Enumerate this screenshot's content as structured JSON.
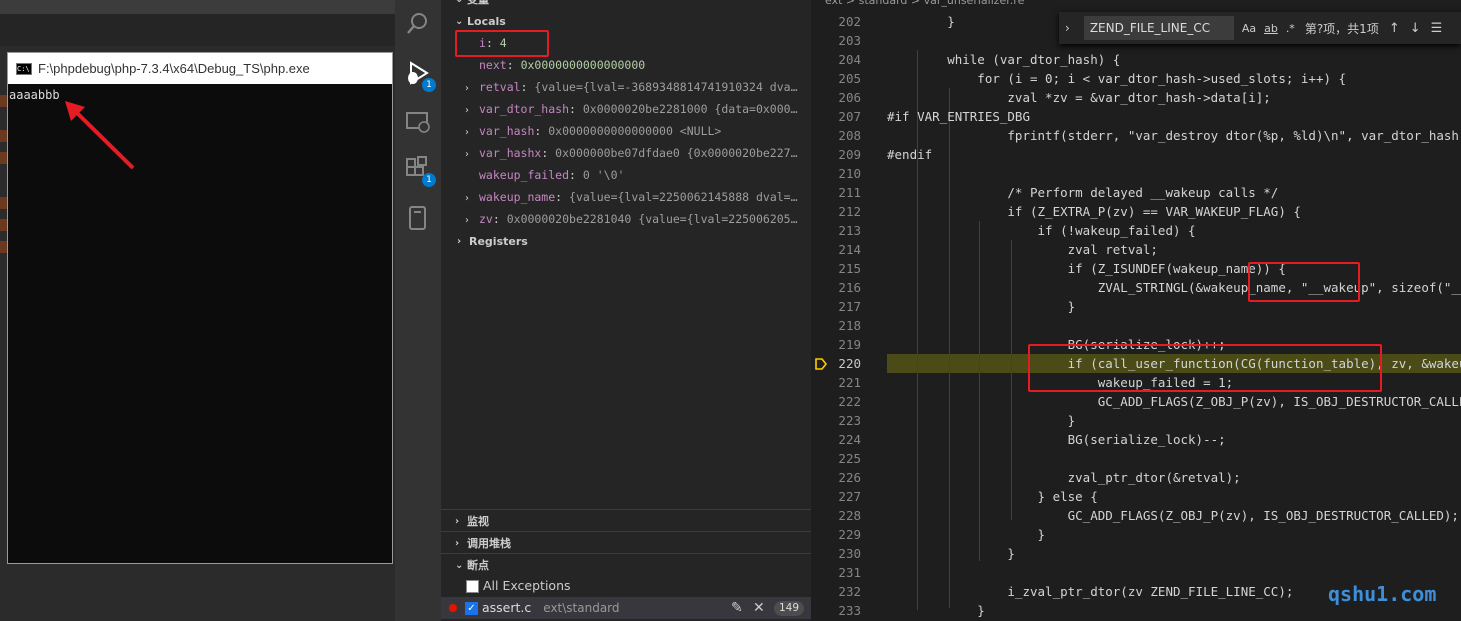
{
  "console": {
    "title": "F:\\phpdebug\\php-7.3.4\\x64\\Debug_TS\\php.exe",
    "output": "aaaabbb",
    "icon_label": "C:\\"
  },
  "activity_bar": {
    "items": [
      {
        "icon": "search-icon"
      },
      {
        "icon": "debug-icon",
        "badge": "1"
      },
      {
        "icon": "remote-explorer-icon"
      },
      {
        "icon": "extensions-icon",
        "badge": "1"
      },
      {
        "icon": "device-icon"
      }
    ]
  },
  "debug_panel": {
    "top_header": "变量",
    "locals_header": "Locals",
    "variables": [
      {
        "name": "i",
        "value": "4",
        "expandable": false
      },
      {
        "name": "next",
        "value": "0x0000000000000000",
        "expandable": false
      },
      {
        "name": "retval",
        "value": "{value={lval=-3689348814741910324 dva…",
        "expandable": true
      },
      {
        "name": "var_dtor_hash",
        "value": "0x0000020be2281000 {data=0x000…",
        "expandable": true
      },
      {
        "name": "var_hash",
        "value": "0x0000000000000000 <NULL>",
        "expandable": true
      },
      {
        "name": "var_hashx",
        "value": "0x000000be07dfdae0 {0x0000020be227…",
        "expandable": true
      },
      {
        "name": "wakeup_failed",
        "value": "0 '\\0'",
        "expandable": false
      },
      {
        "name": "wakeup_name",
        "value": "{value={lval=2250062145888 dval=…",
        "expandable": true
      },
      {
        "name": "zv",
        "value": "0x0000020be2281040 {value={lval=225006205…",
        "expandable": true
      }
    ],
    "registers_header": "Registers",
    "watch_header": "监视",
    "callstack_header": "调用堆栈",
    "breakpoints_header": "断点",
    "breakpoints": {
      "all_exceptions": "All Exceptions",
      "file": "assert.c",
      "path": "ext\\standard",
      "count": "149"
    }
  },
  "editor": {
    "breadcrumb": "ext > standard > var_unserializer.re",
    "find": {
      "query": "ZEND_FILE_LINE_CC",
      "case_label": "Aa",
      "word_label": "ab",
      "regex_label": ".*",
      "result": "第?项，共1项",
      "prev": "↑",
      "next": "↓",
      "menu": "☰"
    },
    "current_line": "220",
    "lines": [
      {
        "n": "202",
        "text": "        }"
      },
      {
        "n": "203",
        "text": ""
      },
      {
        "n": "204",
        "text": "        while (var_dtor_hash) {"
      },
      {
        "n": "205",
        "text": "            for (i = 0; i < var_dtor_hash->used_slots; i++) {"
      },
      {
        "n": "206",
        "text": "                zval *zv = &var_dtor_hash->data[i];"
      },
      {
        "n": "207",
        "text": "#if VAR_ENTRIES_DBG"
      },
      {
        "n": "208",
        "text": "                fprintf(stderr, \"var_destroy dtor(%p, %ld)\\n\", var_dtor_hash->d"
      },
      {
        "n": "209",
        "text": "#endif"
      },
      {
        "n": "210",
        "text": ""
      },
      {
        "n": "211",
        "text": "                /* Perform delayed __wakeup calls */"
      },
      {
        "n": "212",
        "text": "                if (Z_EXTRA_P(zv) == VAR_WAKEUP_FLAG) {"
      },
      {
        "n": "213",
        "text": "                    if (!wakeup_failed) {"
      },
      {
        "n": "214",
        "text": "                        zval retval;"
      },
      {
        "n": "215",
        "text": "                        if (Z_ISUNDEF(wakeup_name)) {"
      },
      {
        "n": "216",
        "text": "                            ZVAL_STRINGL(&wakeup_name, \"__wakeup\", sizeof(\"__wa"
      },
      {
        "n": "217",
        "text": "                        }"
      },
      {
        "n": "218",
        "text": ""
      },
      {
        "n": "219",
        "text": "                        BG(serialize_lock)++;"
      },
      {
        "n": "220",
        "text": "                        if (call_user_function(CG(function_table), zv, &wakeup_"
      },
      {
        "n": "221",
        "text": "                            wakeup_failed = 1;"
      },
      {
        "n": "222",
        "text": "                            GC_ADD_FLAGS(Z_OBJ_P(zv), IS_OBJ_DESTRUCTOR_CALLED)"
      },
      {
        "n": "223",
        "text": "                        }"
      },
      {
        "n": "224",
        "text": "                        BG(serialize_lock)--;"
      },
      {
        "n": "225",
        "text": ""
      },
      {
        "n": "226",
        "text": "                        zval_ptr_dtor(&retval);"
      },
      {
        "n": "227",
        "text": "                    } else {"
      },
      {
        "n": "228",
        "text": "                        GC_ADD_FLAGS(Z_OBJ_P(zv), IS_OBJ_DESTRUCTOR_CALLED);"
      },
      {
        "n": "229",
        "text": "                    }"
      },
      {
        "n": "230",
        "text": "                }"
      },
      {
        "n": "231",
        "text": ""
      },
      {
        "n": "232",
        "text": "                i_zval_ptr_dtor(zv ZEND_FILE_LINE_CC);"
      },
      {
        "n": "233",
        "text": "            }"
      }
    ]
  },
  "watermark": "qshu1.com",
  "colors": {
    "annotation_red": "#e51c23",
    "highlight_line": "#4b4b18",
    "accent_blue": "#007acc",
    "watermark": "#3f8fd8"
  }
}
